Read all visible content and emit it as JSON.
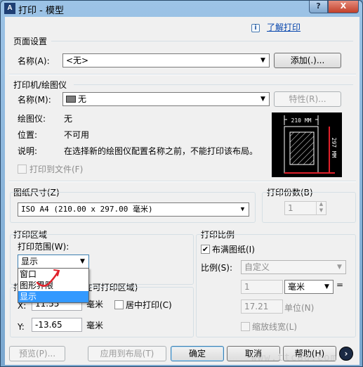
{
  "window": {
    "title": "打印 - 模型",
    "help_button": "?",
    "close_button": "X",
    "app_icon": "autocad-icon"
  },
  "help_link": {
    "icon": "info-icon",
    "label": "了解打印"
  },
  "page_setup": {
    "title": "页面设置",
    "name_label": "名称(A):",
    "name_value": "<无>",
    "add_button": "添加(.)..."
  },
  "printer": {
    "title": "打印机/绘图仪",
    "name_label": "名称(M):",
    "name_value": "无",
    "properties_button": "特性(R)...",
    "plotter_label": "绘图仪:",
    "plotter_value": "无",
    "location_label": "位置:",
    "location_value": "不可用",
    "description_label": "说明:",
    "description_value": "在选择新的绘图仪配置名称之前，不能打印该布局。",
    "print_to_file": "打印到文件(F)",
    "preview_width": "210 MM",
    "preview_height": "297 MM"
  },
  "paper_size": {
    "title": "图纸尺寸(Z)",
    "value": "ISO A4 (210.00 x 297.00 毫米)"
  },
  "copies": {
    "title": "打印份数(B)",
    "value": "1"
  },
  "plot_area": {
    "title": "打印区域",
    "range_label": "打印范围(W):",
    "range_value": "显示",
    "options": [
      "窗口",
      "图形界限",
      "显示"
    ],
    "selected_index": 2
  },
  "plot_offset": {
    "title": "打印偏移(原点设置在可打印区域)",
    "x_label": "X:",
    "x_value": "11.55",
    "x_unit": "毫米",
    "y_label": "Y:",
    "y_value": "-13.65",
    "y_unit": "毫米",
    "center_label": "居中打印(C)"
  },
  "plot_scale": {
    "title": "打印比例",
    "fit_label": "布满图纸(I)",
    "fit_checked": true,
    "scale_label": "比例(S):",
    "scale_value": "自定义",
    "value1": "1",
    "unit_value": "毫米",
    "equals": "=",
    "value2": "17.21",
    "unit_label": "单位(N)",
    "lineweights_label": "缩放线宽(L)"
  },
  "buttons": {
    "preview": "预览(P)...",
    "apply_to_layout": "应用到布局(T)",
    "ok": "确定",
    "cancel": "取消",
    "help": "帮助(H)",
    "expand_icon": "chevron-right-icon"
  },
  "watermark": "www.ttcad.com",
  "colors": {
    "accent_red": "#e0202a",
    "selection": "#3399ff",
    "link": "#0645ad"
  }
}
